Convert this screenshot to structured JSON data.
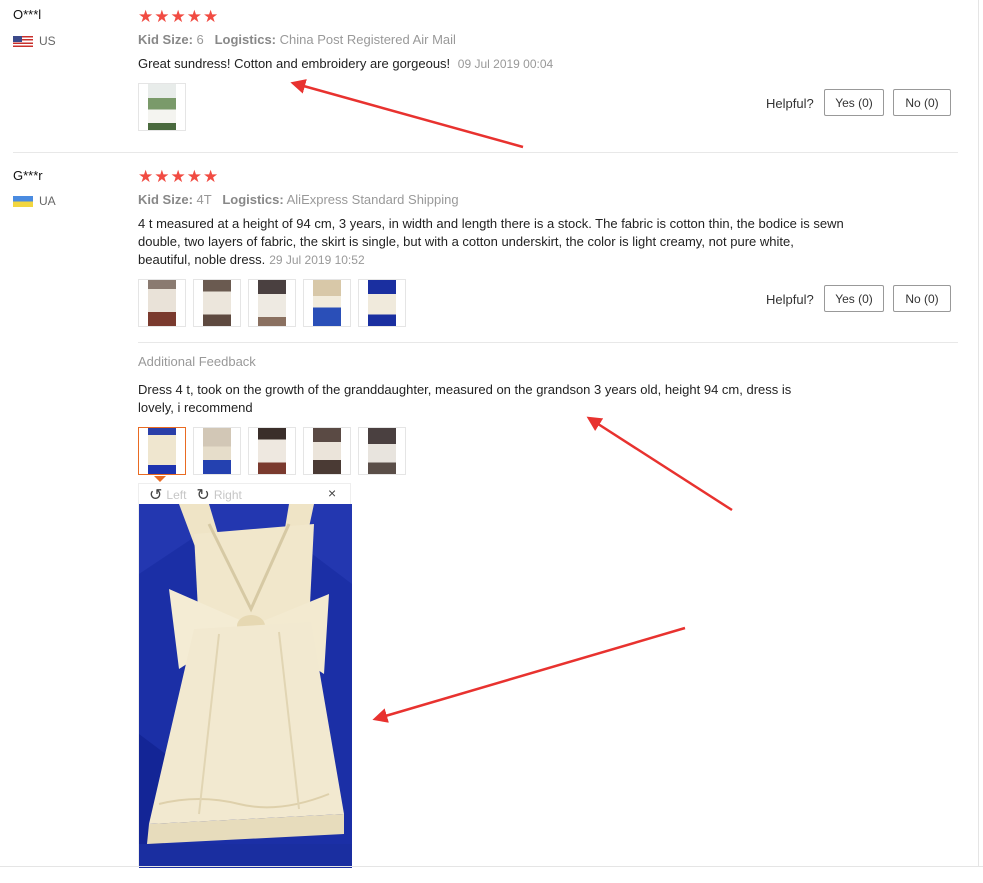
{
  "reviews": [
    {
      "user": "O***l",
      "country": "US",
      "rating_stars": 5,
      "size_label": "Kid Size:",
      "size_value": "6",
      "logistics_label": "Logistics:",
      "logistics_value": "China Post Registered Air Mail",
      "text": "Great sundress! Cotton and embroidery are gorgeous!",
      "date": "09 Jul 2019 00:04",
      "helpful_label": "Helpful?",
      "yes_label": "Yes (0)",
      "no_label": "No (0)"
    },
    {
      "user": "G***r",
      "country": "UA",
      "rating_stars": 5,
      "size_label": "Kid Size:",
      "size_value": "4T",
      "logistics_label": "Logistics:",
      "logistics_value": "AliExpress Standard Shipping",
      "text_lines": [
        "4 t measured at a height of 94 cm, 3 years, in width and length there is a stock. The fabric is cotton thin, the bodice is sewn",
        "double, two layers of fabric, the skirt is single, but with a cotton underskirt, the color is light creamy, not pure white,",
        "beautiful, noble dress."
      ],
      "date": "29 Jul 2019 10:52",
      "helpful_label": "Helpful?",
      "yes_label": "Yes (0)",
      "no_label": "No (0)",
      "additional_feedback_label": "Additional Feedback",
      "additional_lines": [
        "Dress 4 t, took on the growth of the granddaughter, measured on the grandson 3 years old, height 94 cm, dress is",
        "lovely, i recommend"
      ],
      "viewer": {
        "rotate_left_label": "Left",
        "rotate_right_label": "Right",
        "close_label": "×"
      }
    }
  ],
  "colors": {
    "star": "#f14b42",
    "selected_thumb_border": "#e96b22",
    "annotation_arrow": "#e8322f"
  },
  "icons": {
    "star": "★",
    "rotate_left": "↺",
    "rotate_right": "↻"
  }
}
